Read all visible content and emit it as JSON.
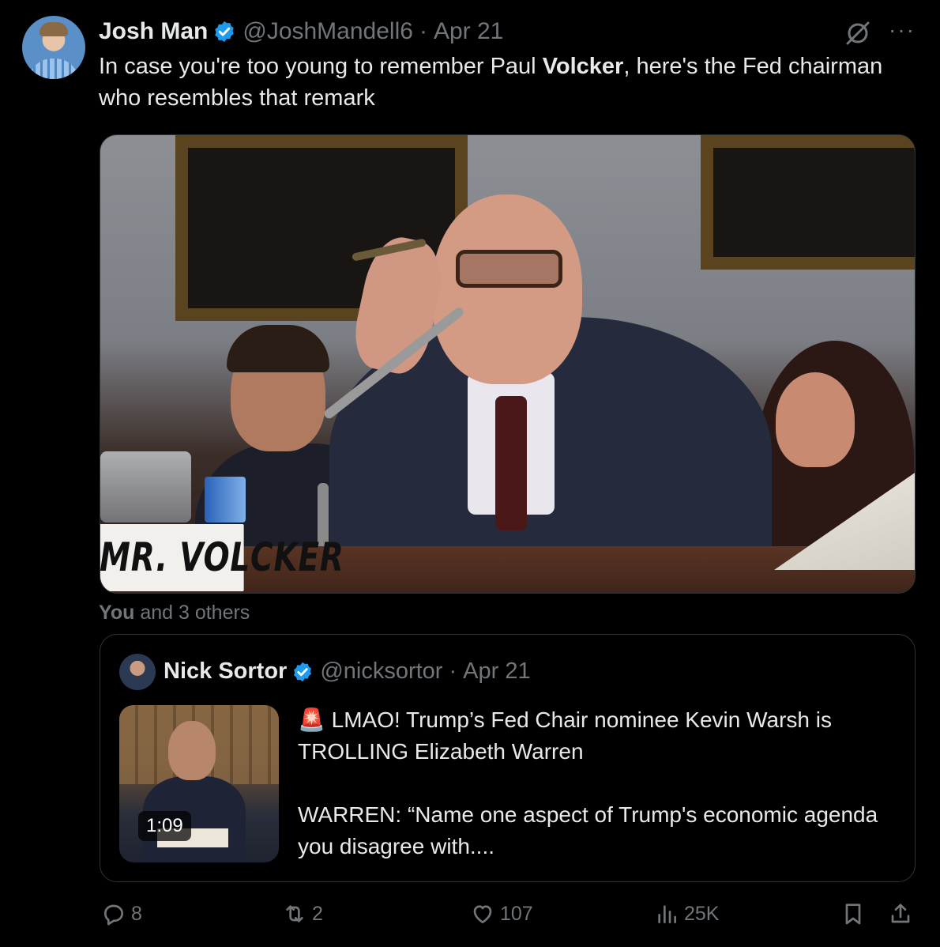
{
  "tweet": {
    "author_name": "Josh Man",
    "handle": "@JoshMandell6",
    "separator": "·",
    "date": "Apr 21",
    "more_icon": "···",
    "text_before": "In case you're too young to remember Paul ",
    "text_bold": "Volcker",
    "text_after": ", here's the Fed chairman who resembles that remark",
    "image_nameplate": "MR. VOLCKER",
    "likers_bold": "You",
    "likers_rest": " and 3 others"
  },
  "quote": {
    "author_name": "Nick Sortor",
    "handle": "@nicksortor",
    "separator": "·",
    "date": "Apr 21",
    "video_duration": "1:09",
    "text": "🚨 LMAO! Trump’s Fed Chair nominee Kevin Warsh is TROLLING Elizabeth Warren\n\nWARREN: “Name one aspect of Trump's economic agenda you disagree with...."
  },
  "actions": {
    "replies": "8",
    "reposts": "2",
    "likes": "107",
    "views": "25K"
  },
  "colors": {
    "background": "#000000",
    "text": "#e7e9ea",
    "muted": "#71767b",
    "border": "#2f3336",
    "verified": "#1d9bf0"
  },
  "icons": {
    "verified": "verified-badge-icon",
    "grok": "grok-icon",
    "more": "more-icon",
    "reply": "reply-icon",
    "repost": "repost-icon",
    "like": "heart-icon",
    "views": "views-icon",
    "bookmark": "bookmark-icon",
    "share": "share-icon"
  }
}
